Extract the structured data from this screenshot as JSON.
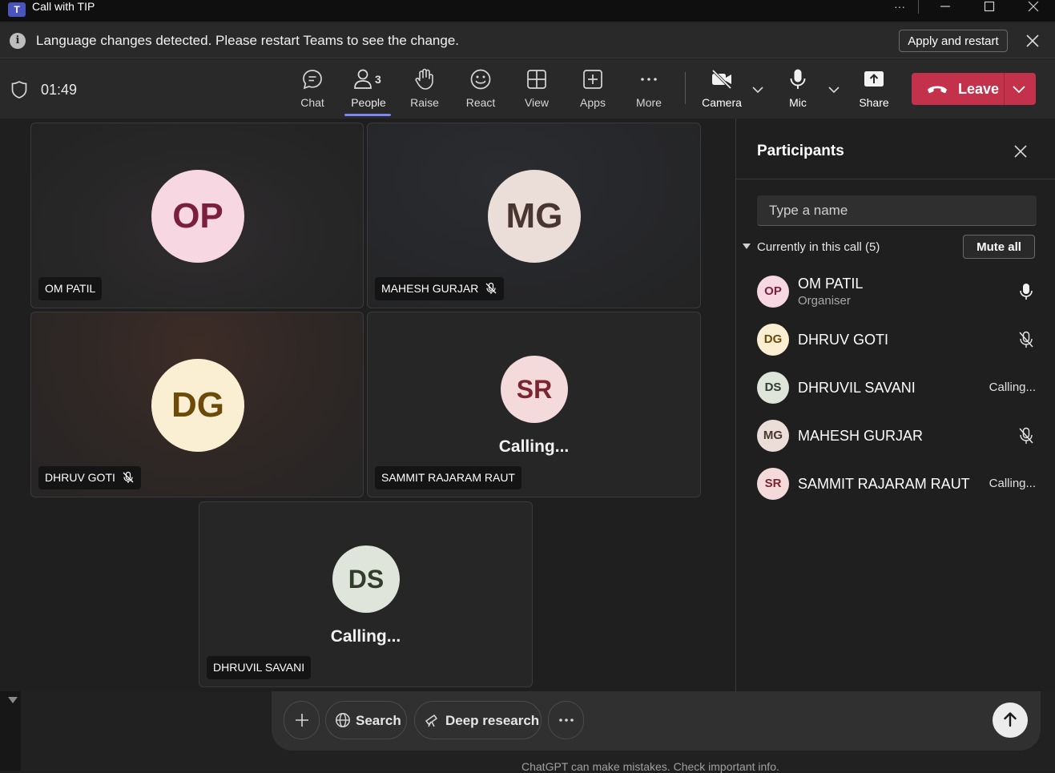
{
  "window": {
    "title": "Call with TIP",
    "logo_text": "T"
  },
  "banner": {
    "message": "Language changes detected. Please restart Teams to see the change.",
    "apply_label": "Apply and restart",
    "info_glyph": "i"
  },
  "toolbar": {
    "timer": "01:49",
    "people_count": "3",
    "buttons": {
      "chat": "Chat",
      "people": "People",
      "raise": "Raise",
      "react": "React",
      "view": "View",
      "apps": "Apps",
      "more": "More",
      "camera": "Camera",
      "mic": "Mic",
      "share": "Share"
    },
    "leave_label": "Leave",
    "active_tab": "people",
    "camera_state": "off"
  },
  "tiles": [
    {
      "initials": "OP",
      "name": "OM PATIL",
      "muted": false,
      "calling": ""
    },
    {
      "initials": "MG",
      "name": "MAHESH GURJAR",
      "muted": true,
      "calling": ""
    },
    {
      "initials": "DG",
      "name": "DHRUV GOTI",
      "muted": true,
      "calling": ""
    },
    {
      "initials": "SR",
      "name": "SAMMIT RAJARAM RAUT",
      "muted": false,
      "calling": "Calling..."
    },
    {
      "initials": "DS",
      "name": "DHRUVIL SAVANI",
      "muted": false,
      "calling": "Calling..."
    }
  ],
  "participants": {
    "title": "Participants",
    "search_placeholder": "Type a name",
    "section_label": "Currently in this call (5)",
    "mute_all_label": "Mute all",
    "list": [
      {
        "initials": "OP",
        "name": "OM PATIL",
        "role": "Organiser",
        "status": "",
        "mic": "on"
      },
      {
        "initials": "DG",
        "name": "DHRUV GOTI",
        "role": "",
        "status": "",
        "mic": "muted"
      },
      {
        "initials": "DS",
        "name": "DHRUVIL SAVANI",
        "role": "",
        "status": "Calling...",
        "mic": ""
      },
      {
        "initials": "MG",
        "name": "MAHESH GURJAR",
        "role": "",
        "status": "",
        "mic": "muted"
      },
      {
        "initials": "SR",
        "name": "SAMMIT RAJARAM RAUT",
        "role": "",
        "status": "Calling...",
        "mic": ""
      }
    ]
  },
  "composer": {
    "search_label": "Search",
    "deep_research_label": "Deep research",
    "disclaimer": "ChatGPT can make mistakes. Check important info."
  },
  "colors": {
    "leave": "#c4314b",
    "accent": "#7f85f5",
    "avatar_op_bg": "#f7d7e1",
    "avatar_op_fg": "#7a1f3d",
    "avatar_mg_bg": "#ebddd8",
    "avatar_mg_fg": "#4a3630",
    "avatar_dg_bg": "#fbefd3",
    "avatar_dg_fg": "#6b4a0a",
    "avatar_sr_bg": "#f5dadc",
    "avatar_sr_fg": "#7a2530",
    "avatar_ds_bg": "#dfe5da",
    "avatar_ds_fg": "#2f3d2a"
  }
}
